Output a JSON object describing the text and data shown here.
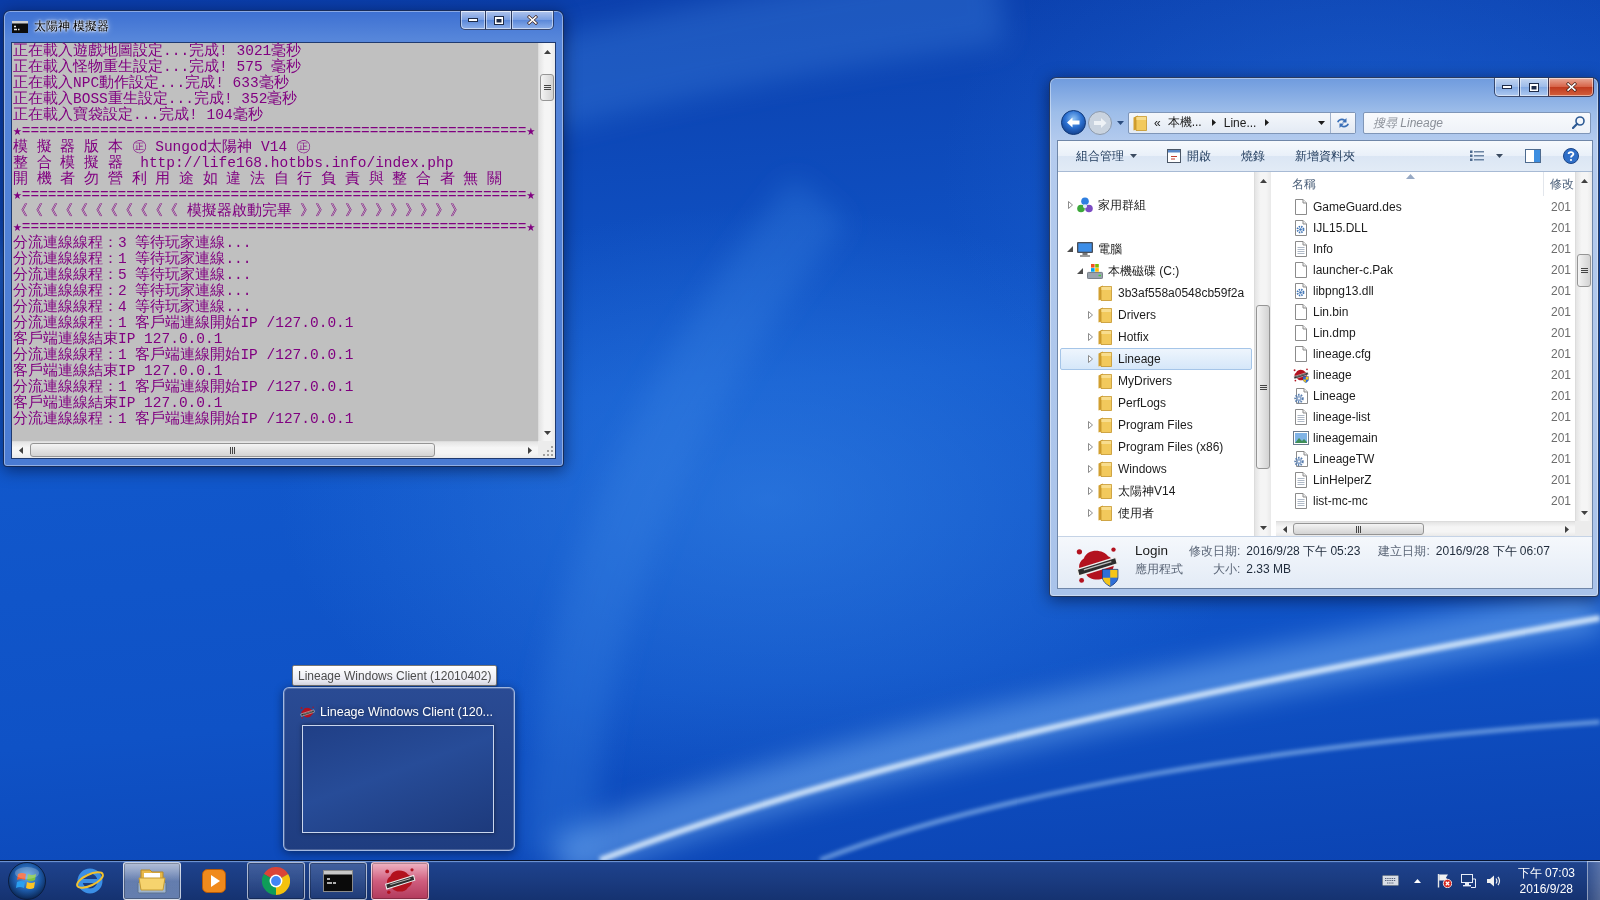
{
  "console_window": {
    "title": "太陽神 模擬器",
    "active": false,
    "lines": [
      "正在載入遊戲地圖設定...完成! 3021毫秒",
      "正在載入怪物重生設定...完成! 575 毫秒",
      "正在載入NPC動作設定...完成! 633毫秒",
      "正在載入BOSS重生設定...完成! 352毫秒",
      "正在載入寶袋設定...完成! 104毫秒",
      "★==========================================================★",
      "模 擬 器 版 本 ㊣ Sungod太陽神 V14 ㊣",
      "整 合 模 擬 器  http://life168.hotbbs.info/index.php",
      "開 機 者 勿 營 利 用 途 如 違 法 自 行 負 責 與 整 合 者 無 關",
      "★==========================================================★",
      "《《《《《《《《《《《 模擬器啟動完畢 》》》》》》》》》》》",
      "★==========================================================★",
      "分流連線線程：3 等待玩家連線...",
      "分流連線線程：1 等待玩家連線...",
      "分流連線線程：5 等待玩家連線...",
      "分流連線線程：2 等待玩家連線...",
      "分流連線線程：4 等待玩家連線...",
      "分流連線線程：1 客戶端連線開始IP /127.0.0.1",
      "客戶端連線結束IP 127.0.0.1",
      "分流連線線程：1 客戶端連線開始IP /127.0.0.1",
      "客戶端連線結束IP 127.0.0.1",
      "分流連線線程：1 客戶端連線開始IP /127.0.0.1",
      "客戶端連線結束IP 127.0.0.1",
      "分流連線線程：1 客戶端連線開始IP /127.0.0.1"
    ]
  },
  "explorer_window": {
    "active": true,
    "address": {
      "overflow": "«",
      "crumbs": [
        "本機...",
        "Line..."
      ]
    },
    "search": {
      "placeholder": "搜尋 Lineage"
    },
    "toolbar": [
      {
        "label": "組合管理",
        "kind": "menu"
      },
      {
        "label": "開啟",
        "kind": "open"
      },
      {
        "label": "燒錄",
        "kind": "plain"
      },
      {
        "label": "新增資料夾",
        "kind": "plain"
      }
    ],
    "nav_tree": [
      {
        "label": "家用群組",
        "kind": "homegroup",
        "expandable": true,
        "expanded": false,
        "selected": false
      },
      {
        "label": "電腦",
        "kind": "computer",
        "expandable": true,
        "expanded": true,
        "selected": false,
        "children": [
          {
            "label": "本機磁碟 (C:)",
            "kind": "drive",
            "expandable": true,
            "expanded": true,
            "selected": false,
            "children": [
              {
                "label": "3b3af558a0548cb59f2a",
                "kind": "folder",
                "expandable": false,
                "expanded": false,
                "selected": false
              },
              {
                "label": "Drivers",
                "kind": "folder",
                "expandable": true,
                "expanded": false,
                "selected": false
              },
              {
                "label": "Hotfix",
                "kind": "folder",
                "expandable": true,
                "expanded": false,
                "selected": false
              },
              {
                "label": "Lineage",
                "kind": "folder",
                "expandable": true,
                "expanded": false,
                "selected": true
              },
              {
                "label": "MyDrivers",
                "kind": "folder",
                "expandable": false,
                "expanded": false,
                "selected": false
              },
              {
                "label": "PerfLogs",
                "kind": "folder",
                "expandable": false,
                "expanded": false,
                "selected": false
              },
              {
                "label": "Program Files",
                "kind": "folder",
                "expandable": true,
                "expanded": false,
                "selected": false
              },
              {
                "label": "Program Files (x86)",
                "kind": "folder",
                "expandable": true,
                "expanded": false,
                "selected": false
              },
              {
                "label": "Windows",
                "kind": "folder",
                "expandable": true,
                "expanded": false,
                "selected": false
              },
              {
                "label": "太陽神V14",
                "kind": "folder",
                "expandable": true,
                "expanded": false,
                "selected": false
              },
              {
                "label": "使用者",
                "kind": "folder",
                "expandable": true,
                "expanded": false,
                "selected": false
              }
            ]
          }
        ]
      }
    ],
    "columns": [
      {
        "label": "名稱",
        "sorted": true
      },
      {
        "label": "修改",
        "sorted": false
      }
    ],
    "files": [
      {
        "name": "GameGuard.des",
        "kind": "blank",
        "modified": "201"
      },
      {
        "name": "IJL15.DLL",
        "kind": "library",
        "modified": "201"
      },
      {
        "name": "Info",
        "kind": "text",
        "modified": "201"
      },
      {
        "name": "launcher-c.Pak",
        "kind": "blank",
        "modified": "201"
      },
      {
        "name": "libpng13.dll",
        "kind": "library",
        "modified": "201"
      },
      {
        "name": "Lin.bin",
        "kind": "blank",
        "modified": "201"
      },
      {
        "name": "Lin.dmp",
        "kind": "blank",
        "modified": "201"
      },
      {
        "name": "lineage.cfg",
        "kind": "blank",
        "modified": "201"
      },
      {
        "name": "lineage",
        "kind": "program",
        "modified": "201"
      },
      {
        "name": "Lineage",
        "kind": "settings",
        "modified": "201"
      },
      {
        "name": "lineage-list",
        "kind": "text",
        "modified": "201"
      },
      {
        "name": "lineagemain",
        "kind": "image",
        "modified": "201"
      },
      {
        "name": "LineageTW",
        "kind": "settings",
        "modified": "201"
      },
      {
        "name": "LinHelperZ",
        "kind": "text",
        "modified": "201"
      },
      {
        "name": "list-mc-mc",
        "kind": "text",
        "modified": "201"
      }
    ],
    "details": {
      "name": "Login",
      "type": "應用程式",
      "fields": [
        {
          "label": "修改日期:",
          "value": "2016/9/28 下午 05:23"
        },
        {
          "label": "建立日期:",
          "value": "2016/9/28 下午 06:07"
        },
        {
          "label": "大小:",
          "value": "2.33 MB"
        }
      ]
    }
  },
  "thumbnail": {
    "tooltip": "Lineage Windows Client (12010402)",
    "title": "Lineage Windows Client (120..."
  },
  "taskbar": {
    "apps": [
      {
        "kind": "ie",
        "running": false,
        "active": false,
        "hovered": false
      },
      {
        "kind": "explorer",
        "running": true,
        "active": true,
        "hovered": false
      },
      {
        "kind": "player",
        "running": false,
        "active": false,
        "hovered": false
      },
      {
        "kind": "chrome",
        "running": true,
        "active": false,
        "hovered": false
      },
      {
        "kind": "console",
        "running": true,
        "active": false,
        "hovered": false
      },
      {
        "kind": "game",
        "running": true,
        "active": false,
        "hovered": true
      }
    ],
    "clock": {
      "time": "下午 07:03",
      "date": "2016/9/28"
    }
  }
}
